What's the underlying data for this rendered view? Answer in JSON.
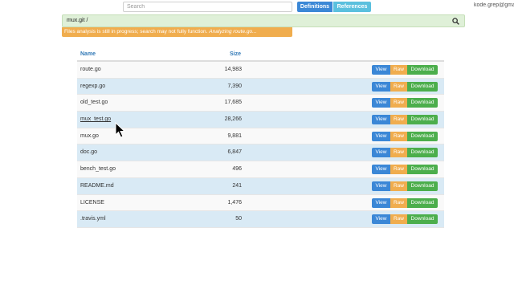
{
  "header": {
    "search_placeholder": "Search",
    "definitions_label": "Definitions",
    "references_label": "References",
    "user_email": "kode.grep@gmail.com"
  },
  "breadcrumb": {
    "path": "mux.git /",
    "search_icon": "search-icon"
  },
  "warning": {
    "text": "Files analysis is still in progress; search may not fully function.",
    "status": "Analyzing route.go..."
  },
  "table": {
    "columns": {
      "name": "Name",
      "size": "Size"
    },
    "actions": {
      "view": "View",
      "raw": "Raw",
      "download": "Download"
    },
    "rows": [
      {
        "name": "route.go",
        "size": "14,983"
      },
      {
        "name": "regexp.go",
        "size": "7,390"
      },
      {
        "name": "old_test.go",
        "size": "17,685"
      },
      {
        "name": "mux_test.go",
        "size": "28,266"
      },
      {
        "name": "mux.go",
        "size": "9,881"
      },
      {
        "name": "doc.go",
        "size": "6,847"
      },
      {
        "name": "bench_test.go",
        "size": "496"
      },
      {
        "name": "README.md",
        "size": "241"
      },
      {
        "name": "LICENSE",
        "size": "1,476"
      },
      {
        "name": ".travis.yml",
        "size": "50"
      }
    ]
  },
  "colors": {
    "primary": "#3b87d6",
    "info": "#5bc0de",
    "warning": "#f0ad4e",
    "success": "#4cae4c",
    "highlight_row": "#d9eaf5",
    "breadcrumb_bg": "#dff0d8"
  }
}
